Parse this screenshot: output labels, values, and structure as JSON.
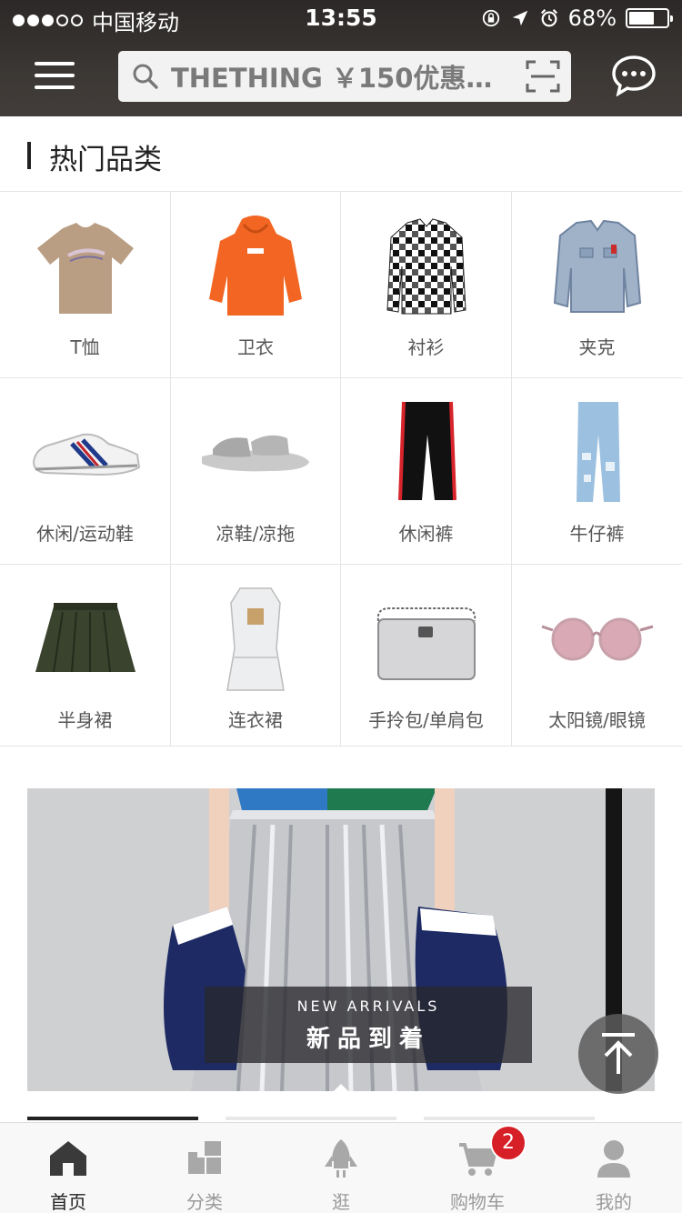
{
  "status_bar": {
    "carrier": "中国移动",
    "time": "13:55",
    "battery": "68%",
    "battery_level": 0.68,
    "signal_bars": 3
  },
  "header": {
    "search_placeholder": "THETHING ￥150优惠券...",
    "icons": [
      "menu-icon",
      "search-icon",
      "scan-icon",
      "message-icon"
    ]
  },
  "section": {
    "title": "热门品类"
  },
  "categories": [
    {
      "label": "T恤",
      "icon": "tshirt"
    },
    {
      "label": "卫衣",
      "icon": "hoodie"
    },
    {
      "label": "衬衫",
      "icon": "shirt"
    },
    {
      "label": "夹克",
      "icon": "jacket"
    },
    {
      "label": "休闲/运动鞋",
      "icon": "sneaker"
    },
    {
      "label": "凉鞋/凉拖",
      "icon": "slide"
    },
    {
      "label": "休闲裤",
      "icon": "pants"
    },
    {
      "label": "牛仔裤",
      "icon": "jeans"
    },
    {
      "label": "半身裙",
      "icon": "skirt"
    },
    {
      "label": "连衣裙",
      "icon": "dress"
    },
    {
      "label": "手拎包/单肩包",
      "icon": "bag"
    },
    {
      "label": "太阳镜/眼镜",
      "icon": "glasses"
    }
  ],
  "banner": {
    "subtitle": "NEW ARRIVALS",
    "title": "新品到着"
  },
  "tabs": [
    {
      "label": "首页",
      "icon": "home-icon",
      "active": true
    },
    {
      "label": "分类",
      "icon": "category-icon",
      "active": false
    },
    {
      "label": "逛",
      "icon": "rocket-icon",
      "active": false
    },
    {
      "label": "购物车",
      "icon": "cart-icon",
      "active": false
    },
    {
      "label": "我的",
      "icon": "user-icon",
      "active": false
    }
  ],
  "cart_badge": "2",
  "colors": {
    "header_bg": "#3b3734",
    "badge": "#d61f26",
    "tab_active": "#222222",
    "tab_inactive": "#9a9a9a"
  }
}
